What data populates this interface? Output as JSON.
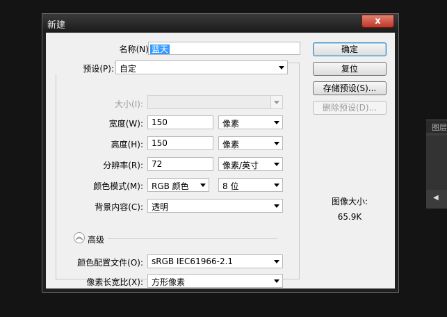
{
  "dialog": {
    "title": "新建",
    "close_glyph": "x"
  },
  "fields": {
    "name": {
      "label": "名称(N):",
      "value": "蓝天"
    },
    "preset": {
      "label": "预设(P):",
      "value": "自定"
    },
    "size": {
      "label": "大小(I):",
      "value": ""
    },
    "width": {
      "label": "宽度(W):",
      "value": "150",
      "unit": "像素"
    },
    "height": {
      "label": "高度(H):",
      "value": "150",
      "unit": "像素"
    },
    "resolution": {
      "label": "分辨率(R):",
      "value": "72",
      "unit": "像素/英寸"
    },
    "color_mode": {
      "label": "颜色模式(M):",
      "value": "RGB 颜色",
      "depth": "8 位"
    },
    "background": {
      "label": "背景内容(C):",
      "value": "透明"
    },
    "advanced": {
      "label": "高级",
      "icon": "collapse-chevron-icon"
    },
    "color_profile": {
      "label": "颜色配置文件(O):",
      "value": "sRGB IEC61966-2.1"
    },
    "pixel_aspect": {
      "label": "像素长宽比(X):",
      "value": "方形像素"
    }
  },
  "buttons": {
    "ok": "确定",
    "reset": "复位",
    "save_preset": "存储预设(S)...",
    "delete_preset": "删除预设(D)..."
  },
  "image_size": {
    "label": "图像大小:",
    "value": "65.9K"
  },
  "background_panel": {
    "tab_label": "图层"
  },
  "colors": {
    "selection": "#3399ff",
    "close_button": "#c03828",
    "default_button_border": "#3c7fb1"
  }
}
